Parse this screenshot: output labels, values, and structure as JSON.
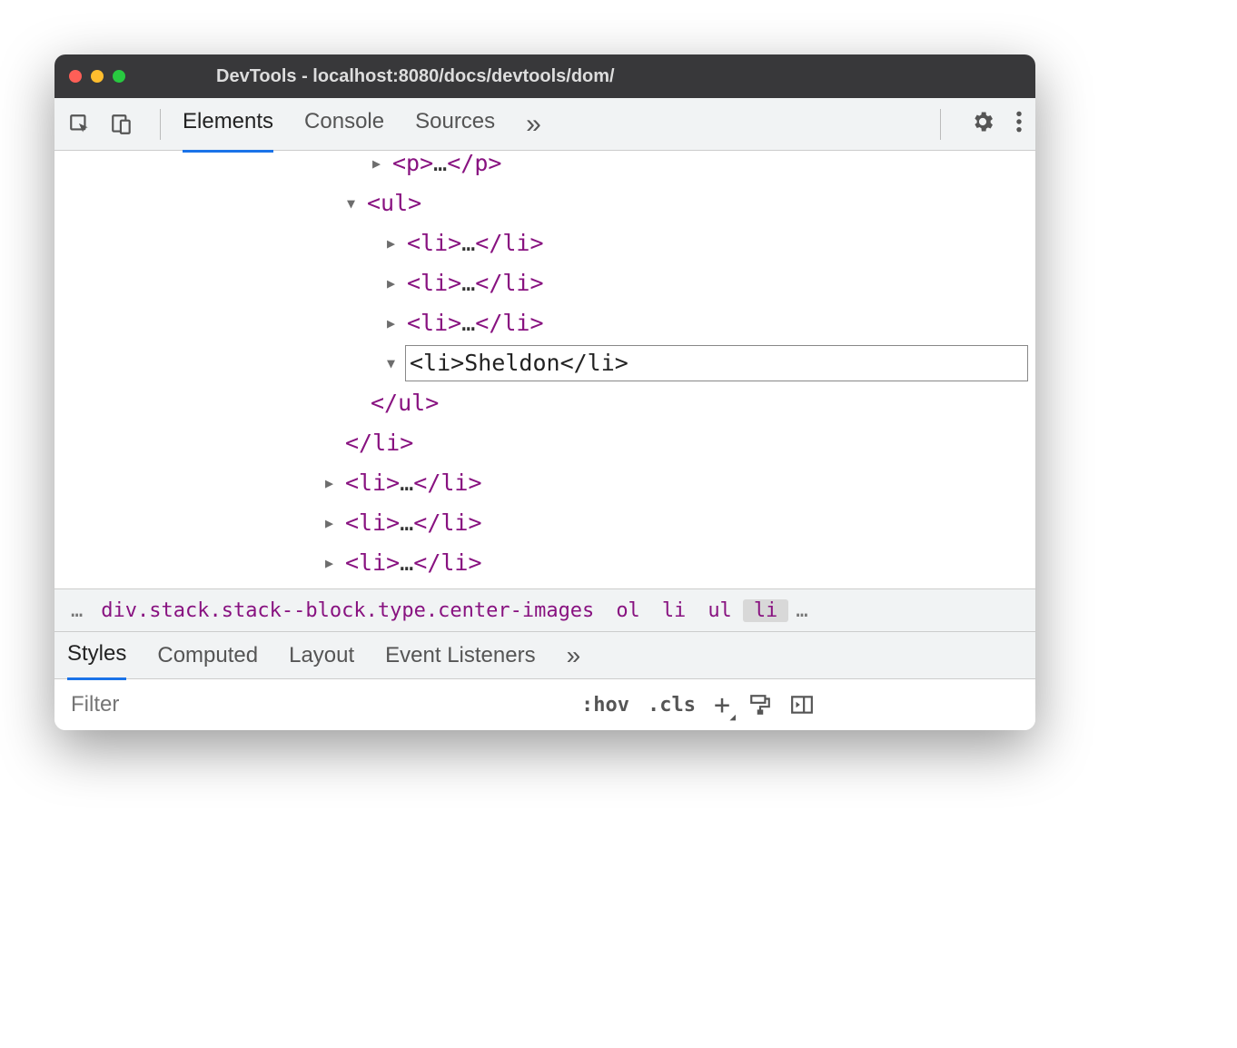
{
  "window": {
    "title": "DevTools - localhost:8080/docs/devtools/dom/"
  },
  "tabs": {
    "elements": "Elements",
    "console": "Console",
    "sources": "Sources"
  },
  "tree": {
    "p_open": "<p>",
    "p_close": "</p>",
    "ul_open": "<ul>",
    "ul_close": "</ul>",
    "li_collapsed_open": "<li>",
    "li_collapsed_close": "</li>",
    "li_close": "</li>",
    "edit": "<li>Sheldon</li>"
  },
  "breadcrumbs": {
    "main": "div.stack.stack--block.type.center-images",
    "b1": "ol",
    "b2": "li",
    "b3": "ul",
    "b4": "li"
  },
  "subtabs": {
    "styles": "Styles",
    "computed": "Computed",
    "layout": "Layout",
    "listeners": "Event Listeners"
  },
  "styles": {
    "filter_placeholder": "Filter",
    "hov": ":hov",
    "cls": ".cls"
  }
}
